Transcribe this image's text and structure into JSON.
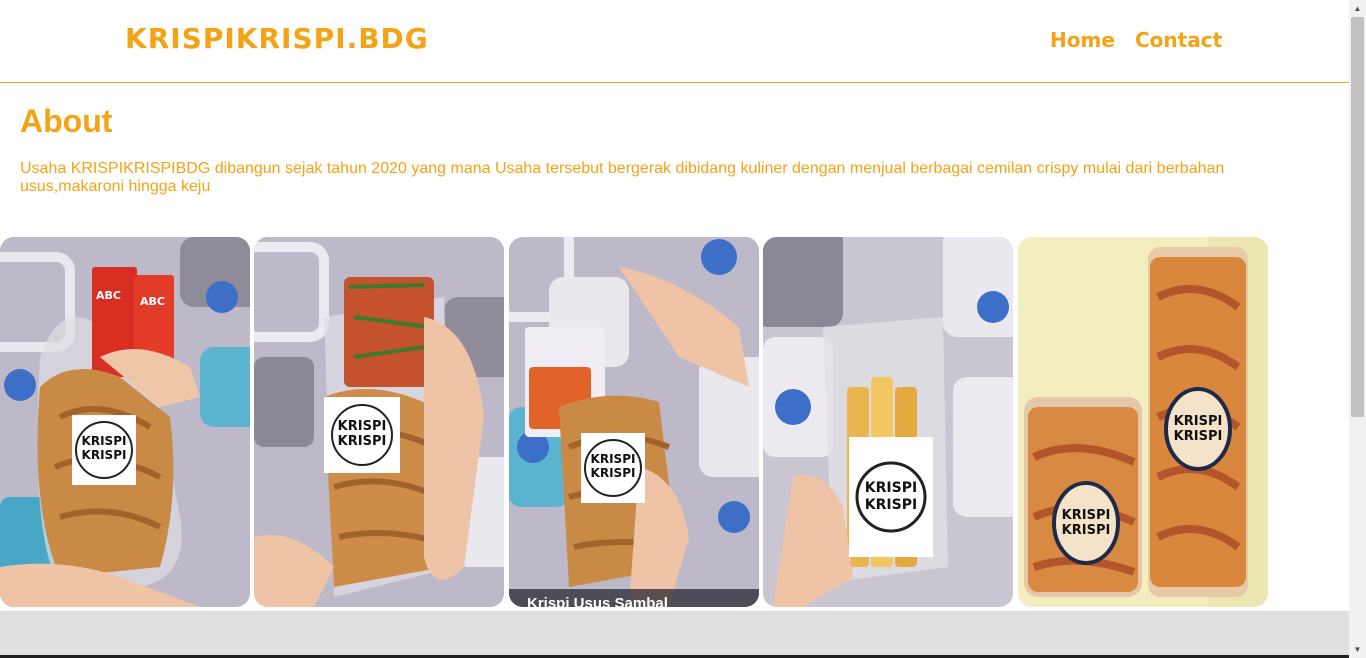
{
  "nav": {
    "brand": "KRISPIKRISPI.BDG",
    "links": [
      "Home",
      "Contact"
    ]
  },
  "about": {
    "title": "About",
    "text": "Usaha KRISPIKRISPIBDG dibangun sejak tahun 2020 yang mana Usaha tersebut bergerak dibidang kuliner dengan menjual berbagai cemilan crispy mulai dari berbahan usus,makaroni hingga keju"
  },
  "gallery": {
    "items": [
      {
        "label": "KRISPI KRISPI",
        "sauce": "ABC"
      },
      {
        "label": "KRISPI KRISPI"
      },
      {
        "label": "KRISPI KRISPI",
        "caption": "Krispi Usus Sambal"
      },
      {
        "label": "KRISPI KRISPI"
      },
      {
        "label": "KRISPI KRISPI"
      }
    ]
  },
  "colors": {
    "accent": "#f5a316",
    "footer": "#e0e0e0"
  },
  "icons": {
    "scroll_up": "arrow-up-icon",
    "scroll_down": "arrow-down-icon"
  }
}
